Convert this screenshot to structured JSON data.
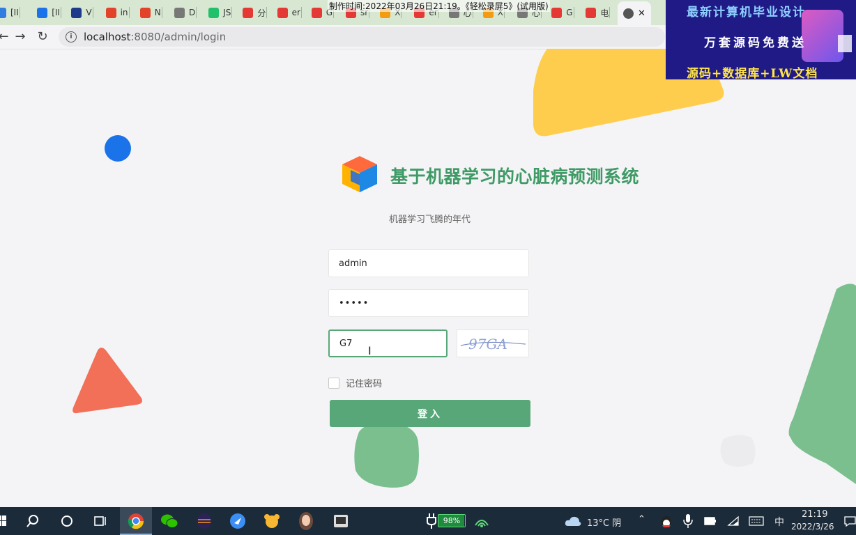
{
  "browser": {
    "tabs": [
      {
        "label": "[II",
        "color": "#2f7de1"
      },
      {
        "label": "[II",
        "color": "#1a73e8"
      },
      {
        "label": "V",
        "color": "#1e3a8a"
      },
      {
        "label": "in",
        "color": "#e24329"
      },
      {
        "label": "N",
        "color": "#e24329"
      },
      {
        "label": "D",
        "color": "#777777"
      },
      {
        "label": "JS",
        "color": "#21c16b"
      },
      {
        "label": "分",
        "color": "#e53935"
      },
      {
        "label": "er",
        "color": "#e53935"
      },
      {
        "label": "G",
        "color": "#e53935"
      },
      {
        "label": "sr",
        "color": "#e53935"
      },
      {
        "label": "X",
        "color": "#f39c12"
      },
      {
        "label": "er",
        "color": "#e53935"
      },
      {
        "label": "心",
        "color": "#777777"
      },
      {
        "label": "X",
        "color": "#f39c12"
      },
      {
        "label": "心",
        "color": "#777777"
      },
      {
        "label": "G",
        "color": "#e53935"
      },
      {
        "label": "电",
        "color": "#e53935"
      }
    ],
    "active_tab_close": "✕",
    "recording_watermark": "制作时间:2022年03月26日21:19。《轻松录屏5》(试用版)",
    "url_host": "localhost",
    "url_rest": ":8080/admin/login"
  },
  "ad_overlay": {
    "line1": "最新计算机毕业设计",
    "line2": "万套源码免费送",
    "line3": "源码+数据库+LW文档"
  },
  "login": {
    "title": "基于机器学习的心脏病预测系统",
    "subtitle": "机器学习飞腾的年代",
    "username_value": "admin",
    "password_value": "•••••",
    "captcha_input_value": "G7",
    "captcha_image_text": "97GA",
    "remember_label": "记住密码",
    "login_button": "登入"
  },
  "taskbar": {
    "battery": "98%",
    "weather": "13°C 阴",
    "ime": "中",
    "time": "21:19",
    "date": "2022/3/26"
  },
  "colors": {
    "accent_green": "#58a778",
    "title_green": "#3f9a66",
    "deco_yellow": "#ffcd4e",
    "deco_blue": "#1a73e8",
    "deco_red": "#f26f58",
    "deco_green": "#7bbf8f"
  }
}
